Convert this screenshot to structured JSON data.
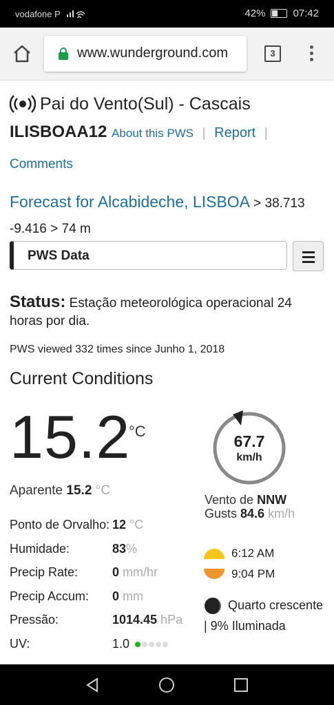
{
  "status_bar": {
    "carrier": "vodafone P",
    "battery": "42%",
    "time": "07:42"
  },
  "browser": {
    "url": "www.wunderground.com",
    "tab_count": "3"
  },
  "station": {
    "name": "Pai do Vento(Sul) - Cascais",
    "id": "ILISBOAA12",
    "about_link": "About this PWS",
    "report_link": "Report",
    "comments_link": "Comments",
    "forecast_link": "Forecast for Alcabideche, LISBOA",
    "coords": "> 38.713 -9.416 > 74 m",
    "pws_select": "PWS Data",
    "status_label": "Status:",
    "status_text": "Estação meteorológica operacional 24 horas por dia.",
    "viewed": "PWS viewed 332 times since Junho 1, 2018"
  },
  "conditions": {
    "heading": "Current Conditions",
    "temp": "15.2",
    "temp_unit": "°C",
    "apparent_label": "Aparente",
    "apparent_value": "15.2",
    "apparent_unit": "°C",
    "rows": [
      {
        "label": "Ponto de Orvalho:",
        "value": "12",
        "unit": "°C"
      },
      {
        "label": "Humidade:",
        "value": "83",
        "unit": "%"
      },
      {
        "label": "Precip Rate:",
        "value": "0",
        "unit": "mm/hr"
      },
      {
        "label": "Precip Accum:",
        "value": "0",
        "unit": "mm"
      },
      {
        "label": "Pressão:",
        "value": "1014.45",
        "unit": "hPa"
      },
      {
        "label": "UV:",
        "value": "1.0",
        "unit": ""
      }
    ],
    "wind_speed": "67.7",
    "wind_unit": "km/h",
    "wind_dir_label": "Vento de",
    "wind_dir": "NNW",
    "gusts_label": "Gusts",
    "gusts_value": "84.6",
    "gusts_unit": "km/h",
    "sunrise": "6:12 AM",
    "sunset": "9:04 PM",
    "moon_text": "Quarto crescente | 9% Iluminada",
    "colors": {
      "sunrise": "#f5c518",
      "sunset": "#f0942e",
      "link": "#1e6f9f",
      "uv_on": "#1fb31f"
    }
  }
}
